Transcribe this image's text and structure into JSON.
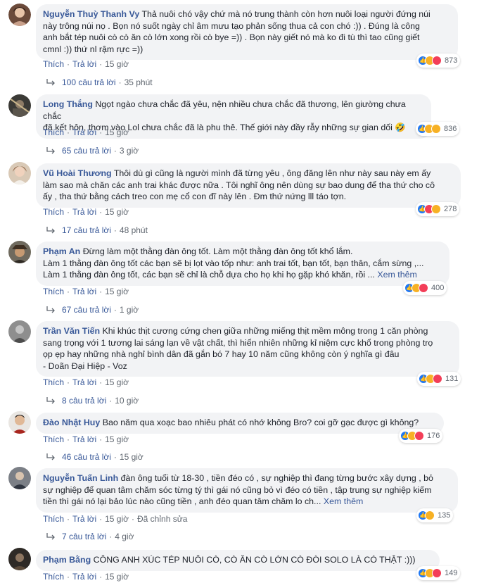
{
  "labels": {
    "like": "Thích",
    "reply": "Trả lời",
    "see_more": "Xem thêm",
    "edited": "Đã chỉnh sửa",
    "replies_suffix": "câu trả lời"
  },
  "comments": [
    {
      "author": "Nguyễn Thuỳ Thanh Vy",
      "lines": [
        "Thả nuôi chó vậy chứ mà nó trung thành còn hơn nuôi loại người đứng núi",
        "này trông núi nọ . Bọn nó suốt ngày chỉ âm mưu tạo phản sống thua cả con chó :)) . Đúng là công",
        "anh bắt tép nuôi cò cò ăn cò lớn xong rồi cò bye =)) . Bọn này giết nó mà ko đi tù thì tao cũng giết",
        "cmnl :)) thứ nl rậm rực =))"
      ],
      "time": "15 giờ",
      "reactions": "873",
      "replies": "100 câu trả lời",
      "replies_time": "35 phút"
    },
    {
      "author": "Long Thắng",
      "lines": [
        "Ngọt ngào chưa chắc đã yêu, nện nhiều chưa chắc đã thương, lên giường chưa chắc",
        "đã kết hôn, thơm vào Lol chưa chắc đã là phu thê. Thế giới này đầy rẫy những sự gian dối 🤣"
      ],
      "time": "15 giờ",
      "reactions": "836",
      "replies": "65 câu trả lời",
      "replies_time": "3 giờ"
    },
    {
      "author": "Vũ Hoài Thương",
      "lines": [
        "Thôi dù gì cũng là người mình đã từng yêu , ông đăng lên như này sau này em ấy",
        "làm sao mà chăn các anh trai khác được nữa . Tôi nghĩ ông nên dùng sự bao dung để tha thứ cho cô",
        "ấy , tha thứ bằng cách treo con mẹ cổ con đĩ này lên . Đm thứ nứng lll táo tợn."
      ],
      "time": "15 giờ",
      "reactions": "278",
      "replies": "17 câu trả lời",
      "replies_time": "48 phút"
    },
    {
      "author": "Phạm An",
      "lines": [
        "Đừng làm một thằng đàn ông tốt. Làm một thằng đàn ông tốt khổ lắm.",
        "Làm 1 thằng đàn ông tốt các bạn sẽ bị lọt vào tốp như: anh trai tốt, bạn tốt, bạn thân, cắm sừng ,...",
        "Làm 1 thằng đàn ông tốt, các bạn sẽ chỉ là chỗ dựa cho họ khi họ gặp khó khăn, rồi ..."
      ],
      "see_more": true,
      "time": "15 giờ",
      "reactions": "400",
      "replies": "67 câu trả lời",
      "replies_time": "1 giờ"
    },
    {
      "author": "Trần Văn Tiến",
      "lines": [
        "Khi khúc thịt cương cứng chen giữa những miếng thịt mềm mông trong 1 căn phòng",
        "sang trọng với 1 tương lai sáng lạn về vật chất, thì hiển nhiên những kỉ niệm cực khổ trong phòng trọ",
        "ọp ẹp hay những nhà nghỉ bình dân đã gắn bó 7 hay 10 năm cũng không còn ý nghĩa gì đâu",
        "- Doãn Đại Hiệp - Voz"
      ],
      "time": "15 giờ",
      "reactions": "131",
      "replies": "8 câu trả lời",
      "replies_time": "10 giờ"
    },
    {
      "author": "Đào Nhật Huy",
      "lines": [
        "Bao năm qua xoạc bao nhiêu phát có nhớ không Bro? coi gỡ gạc được gì không?"
      ],
      "time": "15 giờ",
      "reactions": "176",
      "replies": "46 câu trả lời",
      "replies_time": "15 giờ"
    },
    {
      "author": "Nguyễn Tuấn Linh",
      "lines": [
        "đàn ông tuổi từ 18-30 , tiền đéo có , sự nghiệp thì đang từng bước xây dựng , bỏ",
        "sự nghiệp để quan tâm chăm sóc từng tý thì gái nó cũng bỏ vì đéo có tiền , tập trung sự nghiệp kiếm",
        "tiền thì gái nó lại bảo lúc nào cũng tiền , anh đéo quan tâm chăm lo ch..."
      ],
      "see_more": true,
      "time": "15 giờ",
      "edited": true,
      "reactions": "135",
      "replies": "7 câu trả lời",
      "replies_time": "4 giờ"
    },
    {
      "author": "Phạm Bằng",
      "lines": [
        "CÔNG ANH XÚC TÉP NUÔI CÒ, CÒ ĂN CÒ LỚN CÒ ĐÒI SOLO LÀ CÓ THẬT :)))"
      ],
      "time": "15 giờ",
      "reactions": "149"
    }
  ]
}
